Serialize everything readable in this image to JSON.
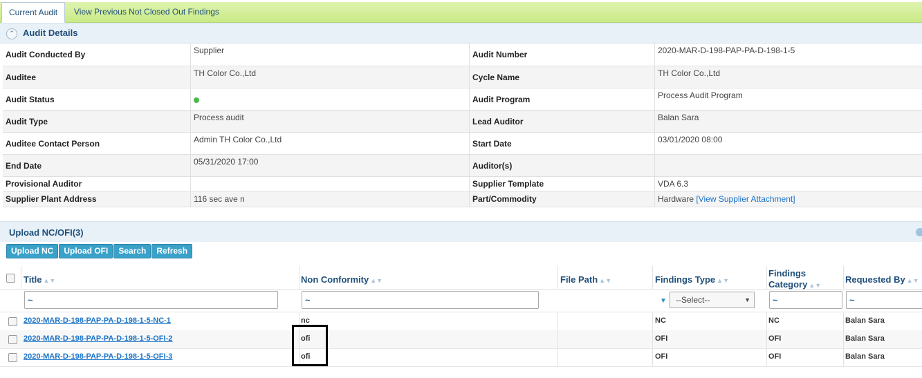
{
  "tabs": [
    {
      "label": "Current Audit"
    },
    {
      "label": "View Previous Not Closed Out Findings"
    }
  ],
  "audit_details": {
    "header": "Audit Details",
    "rows": [
      {
        "l1": "Audit Conducted By",
        "v1": "Supplier",
        "l2": "Audit Number",
        "v2": "2020-MAR-D-198-PAP-PA-D-198-1-5"
      },
      {
        "l1": "Auditee",
        "v1": "TH Color Co.,Ltd",
        "l2": "Cycle Name",
        "v2": "TH Color Co.,Ltd"
      },
      {
        "l1": "Audit Status",
        "v1": "",
        "l2": "Audit Program",
        "v2": "Process Audit Program"
      },
      {
        "l1": "Audit Type",
        "v1": "Process audit",
        "l2": "Lead Auditor",
        "v2": "Balan Sara"
      },
      {
        "l1": "Auditee Contact Person",
        "v1": "Admin TH Color Co.,Ltd",
        "l2": "Start Date",
        "v2": "03/01/2020 08:00"
      },
      {
        "l1": "End Date",
        "v1": "05/31/2020 17:00",
        "l2": "Auditor(s)",
        "v2": ""
      },
      {
        "l1": "Provisional Auditor",
        "v1": "",
        "l2": "Supplier Template",
        "v2": "VDA 6.3"
      },
      {
        "l1": "Supplier Plant Address",
        "v1": "116 sec ave n",
        "l2": "Part/Commodity",
        "v2": "Hardware"
      }
    ],
    "attachment_link": "[View Supplier Attachment]",
    "status_color": "#4cb84c"
  },
  "upload": {
    "header": "Upload NC/OFI(3)",
    "buttons": {
      "upload_nc": "Upload NC",
      "upload_ofi": "Upload OFI",
      "search": "Search",
      "refresh": "Refresh"
    }
  },
  "grid": {
    "columns": {
      "title": "Title",
      "non_conformity": "Non Conformity",
      "file_path": "File Path",
      "findings_type": "Findings Type",
      "findings_category_1": "Findings",
      "findings_category_2": "Category",
      "requested_by": "Requested By"
    },
    "filter": {
      "tilde": "~",
      "select_value": "--Select--"
    },
    "rows": [
      {
        "title": "2020-MAR-D-198-PAP-PA-D-198-1-5-NC-1",
        "nc": "nc",
        "type": "NC",
        "category": "NC",
        "requested_by": "Balan Sara"
      },
      {
        "title": "2020-MAR-D-198-PAP-PA-D-198-1-5-OFI-2",
        "nc": "ofi",
        "type": "OFI",
        "category": "OFI",
        "requested_by": "Balan Sara"
      },
      {
        "title": "2020-MAR-D-198-PAP-PA-D-198-1-5-OFI-3",
        "nc": "ofi",
        "type": "OFI",
        "category": "OFI",
        "requested_by": "Balan Sara"
      }
    ]
  }
}
